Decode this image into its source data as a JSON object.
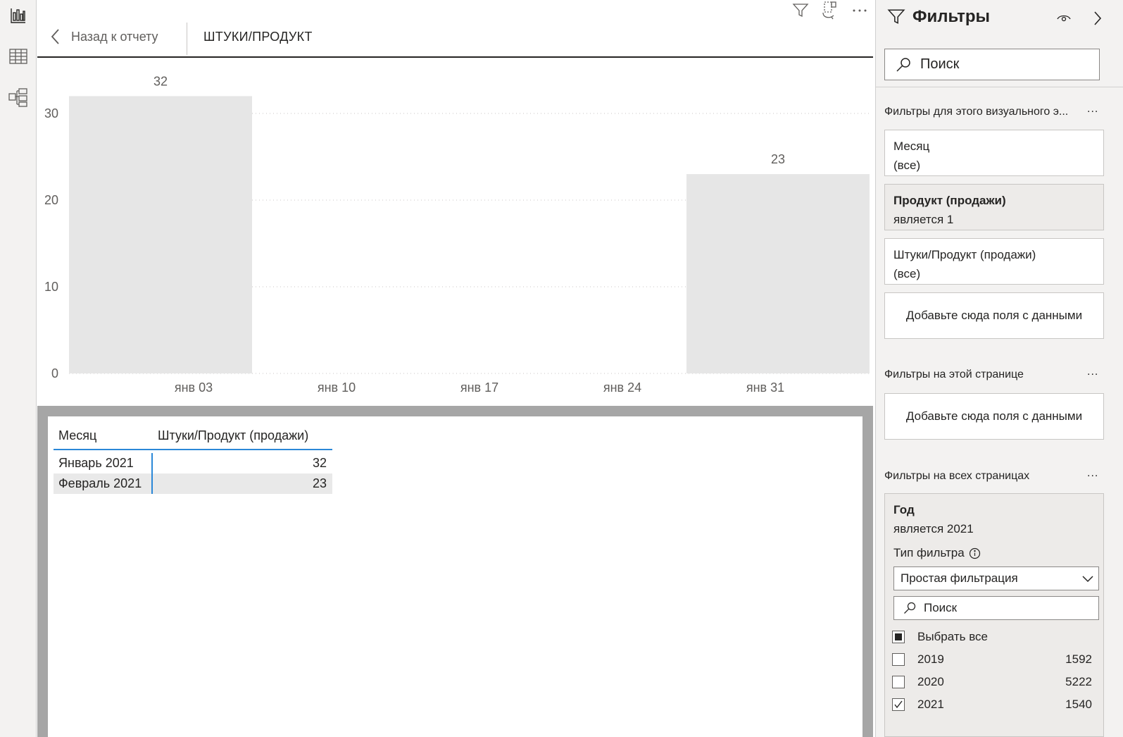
{
  "header": {
    "back_label": "Назад к отчету",
    "page_title": "ШТУКИ/ПРОДУКТ"
  },
  "chart_data": {
    "type": "bar",
    "x": [
      "янв 03",
      "янв 31"
    ],
    "values": [
      32,
      23
    ],
    "data_labels": [
      "32",
      "23"
    ],
    "x_ticks": [
      "янв 03",
      "янв 10",
      "янв 17",
      "янв 24",
      "янв 31"
    ],
    "y_ticks": [
      "0",
      "10",
      "20",
      "30"
    ],
    "ylim": [
      0,
      34
    ],
    "grid": true,
    "bar_color": "#e6e6e6"
  },
  "table": {
    "columns": [
      "Месяц",
      "Штуки/Продукт (продажи)"
    ],
    "rows": [
      {
        "month": "Январь 2021",
        "value": "32"
      },
      {
        "month": "Февраль 2021",
        "value": "23"
      }
    ]
  },
  "filters": {
    "title": "Фильтры",
    "search_placeholder": "Поиск",
    "visual_section": "Фильтры для этого визуального э...",
    "visual_cards": [
      {
        "title": "Месяц",
        "value": "(все)"
      },
      {
        "title": "Продукт (продажи)",
        "value": "является 1"
      },
      {
        "title": "Штуки/Продукт (продажи)",
        "value": "(все)"
      }
    ],
    "drop_zone": "Добавьте сюда поля с данными",
    "page_section": "Фильтры на этой странице",
    "all_pages_section": "Фильтры на всех страницах",
    "more": "...",
    "year_card": {
      "title": "Год",
      "value": "является 2021",
      "filter_type_label": "Тип фильтра",
      "filter_type_value": "Простая фильтрация",
      "search_placeholder": "Поиск",
      "options": [
        {
          "label": "Выбрать все",
          "count": "",
          "state": "partial"
        },
        {
          "label": "2019",
          "count": "1592",
          "state": "unchecked"
        },
        {
          "label": "2020",
          "count": "5222",
          "state": "unchecked"
        },
        {
          "label": "2021",
          "count": "1540",
          "state": "checked"
        }
      ]
    }
  },
  "colors": {
    "accent": "#2b88d8",
    "pane_bg": "#f3f2f1",
    "text": "#252423"
  }
}
